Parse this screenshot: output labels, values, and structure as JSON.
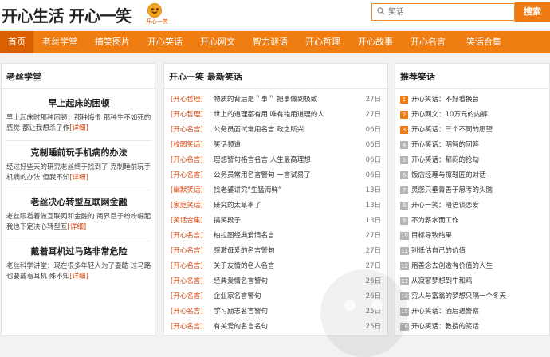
{
  "header": {
    "site_title": "开心生活 开心一笑",
    "logo_text": "开心一笑",
    "search_placeholder": "笑话",
    "search_button": "搜索"
  },
  "nav": {
    "items": [
      "首页",
      "老丝学堂",
      "搞笑图片",
      "开心笑话",
      "开心网文",
      "智力谜语",
      "开心哲理",
      "开心故事",
      "开心名言",
      "笑话合集"
    ],
    "active_index": 0
  },
  "left": {
    "title": "老丝学堂",
    "articles": [
      {
        "title": "早上起床的困顿",
        "summary": "早上起床时那种困顿，那种悔恨 那种生不如死的感觉 都让我想杀了作",
        "more": "[详细]"
      },
      {
        "title": "克制睡前玩手机病的办法",
        "summary": "经过好些天的研究老丝终于找到了 克制睡前玩手机病的办法 但我不知",
        "more": "[详细]"
      },
      {
        "title": "老丝决心转型互联网金融",
        "summary": "老丝眼看着做互联网和金融的 商界巨子纷纷崛起 我也下定决心转型互",
        "more": "[详细]"
      },
      {
        "title": "戴着耳机过马路非常危险",
        "summary": "老丝科学讲堂：现在很多年轻人为了耍酷 过马路也要戴着耳机 殊不知",
        "more": "[详细]"
      }
    ]
  },
  "middle": {
    "title": "开心一笑 最新笑话",
    "rows": [
      {
        "cat": "[开心哲理]",
        "text": "物质的背后是＂事＂ 把事做到极致",
        "date": "27日"
      },
      {
        "cat": "[开心哲理]",
        "text": "世上的道理都有用 唯有错用道理的人",
        "date": "27日"
      },
      {
        "cat": "[开心名言]",
        "text": "公务员面试常用名言 政之所兴",
        "date": "06日"
      },
      {
        "cat": "[校园笑话]",
        "text": "笑话频道",
        "date": "06日"
      },
      {
        "cat": "[开心名言]",
        "text": "理想警句格言名言 人生最高理想",
        "date": "06日"
      },
      {
        "cat": "[开心名言]",
        "text": "公务员常用名言警句 一言试易了",
        "date": "06日"
      },
      {
        "cat": "[幽默笑话]",
        "text": "找老婆讲究“生猛海鲜”",
        "date": "13日"
      },
      {
        "cat": "[家庭笑话]",
        "text": "研究的太草率了",
        "date": "13日"
      },
      {
        "cat": "[笑话合集]",
        "text": "搞笑段子",
        "date": "13日"
      },
      {
        "cat": "[开心名言]",
        "text": "柏拉图经典爱情名言",
        "date": "27日"
      },
      {
        "cat": "[开心名言]",
        "text": "感激母爱的名言警句",
        "date": "27日"
      },
      {
        "cat": "[开心名言]",
        "text": "关于友情的名人名言",
        "date": "27日"
      },
      {
        "cat": "[开心名言]",
        "text": "经典爱情名言警句",
        "date": "26日"
      },
      {
        "cat": "[开心名言]",
        "text": "企业家名言警句",
        "date": "26日"
      },
      {
        "cat": "[开心名言]",
        "text": "学习励志名言警句",
        "date": "25日"
      },
      {
        "cat": "[开心名言]",
        "text": "有关爱的名言名句",
        "date": "25日"
      }
    ]
  },
  "right": {
    "title": "推荐笑话",
    "rows": [
      {
        "num": "1",
        "text": "开心笑话：不好看换台"
      },
      {
        "num": "2",
        "text": "开心网文：10万元的内裤"
      },
      {
        "num": "3",
        "text": "开心笑话：三个不同的愿望"
      },
      {
        "num": "4",
        "text": "开心笑话：明智的回答"
      },
      {
        "num": "5",
        "text": "开心笑话：郁闷的抢劫"
      },
      {
        "num": "6",
        "text": "饭店经理与擦鞋匠的对话"
      },
      {
        "num": "7",
        "text": "灵感只垂青善于思考的头脑"
      },
      {
        "num": "8",
        "text": "开心一笑：暗语谈恋爱"
      },
      {
        "num": "9",
        "text": "不为薪水而工作"
      },
      {
        "num": "10",
        "text": "目标导致结果"
      },
      {
        "num": "11",
        "text": "别低估自己的价值"
      },
      {
        "num": "12",
        "text": "用善念去创造有价值的人生"
      },
      {
        "num": "13",
        "text": "从寂寥梦想到牛和鸡"
      },
      {
        "num": "14",
        "text": "穷人与富翁的梦想只隔一个冬天"
      },
      {
        "num": "15",
        "text": "开心笑话：酒后遇警察"
      },
      {
        "num": "16",
        "text": "开心笑话：教授的笑话"
      }
    ]
  },
  "colors": {
    "accent": "#f07d12",
    "accent_dark": "#d95f00",
    "category_red": "#d8430a"
  }
}
